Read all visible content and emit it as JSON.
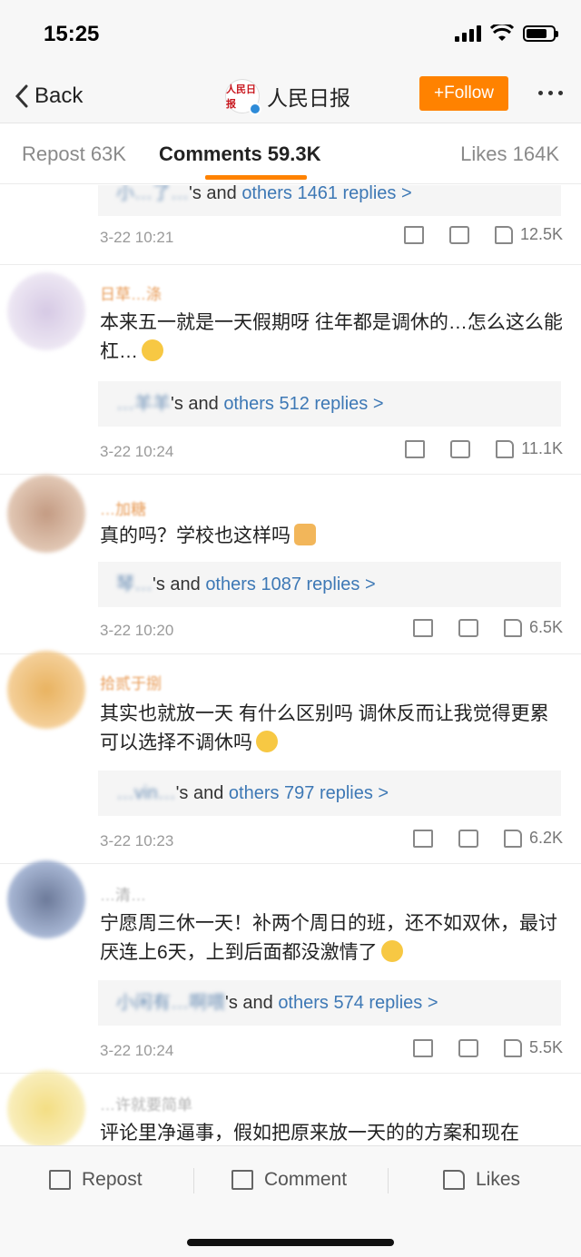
{
  "status": {
    "time": "15:25"
  },
  "nav": {
    "back_label": "Back",
    "account_name": "人民日报",
    "avatar_logo": "人民日报",
    "follow_label": "+Follow"
  },
  "tabs": [
    {
      "label": "Repost 63K",
      "active": false
    },
    {
      "label": "Comments 59.3K",
      "active": true
    },
    {
      "label": "Likes 164K",
      "active": false
    }
  ],
  "comments": [
    {
      "name": "",
      "text": "",
      "reply_names": "小…了…",
      "reply_suffix": "'s and ",
      "reply_link": "others 1461 replies >",
      "time": "3-22 10:21",
      "likes": "12.5K"
    },
    {
      "name": "日草…涤",
      "text": "本来五一就是一天假期呀 往年都是调休的…怎么这么能杠…",
      "reply_names": "…羊羊",
      "reply_suffix": "'s and ",
      "reply_link": "others 512 replies >",
      "time": "3-22 10:24",
      "likes": "11.1K"
    },
    {
      "name": "…加糖",
      "text": "真的吗？学校也这样吗",
      "reply_names": "琴…",
      "reply_suffix": "'s and ",
      "reply_link": "others 1087 replies >",
      "time": "3-22 10:20",
      "likes": "6.5K"
    },
    {
      "name": "拾贰于捌",
      "text": "其实也就放一天 有什么区别吗 调休反而让我觉得更累 可以选择不调休吗",
      "reply_names": "…vin…",
      "reply_suffix": "'s and ",
      "reply_link": "others 797 replies >",
      "time": "3-22 10:23",
      "likes": "6.2K"
    },
    {
      "name": "…清…",
      "text": "宁愿周三休一天！补两个周日的班，还不如双休，最讨厌连上6天，上到后面都没激情了",
      "reply_names": "小闲有…啊喂",
      "reply_suffix": "'s and ",
      "reply_link": "others 574 replies >",
      "time": "3-22 10:24",
      "likes": "5.5K"
    },
    {
      "name": "…许就要简单",
      "text": "评论里净逼事，假如把原来放一天的的方案和现在",
      "reply_names": "",
      "reply_suffix": "",
      "reply_link": "",
      "time": "",
      "likes": ""
    }
  ],
  "bottom": {
    "repost_label": "Repost",
    "comment_label": "Comment",
    "likes_label": "Likes"
  },
  "colors": {
    "accent": "#ff8200",
    "link": "#3d78b5",
    "time": "#9a9a9a"
  }
}
